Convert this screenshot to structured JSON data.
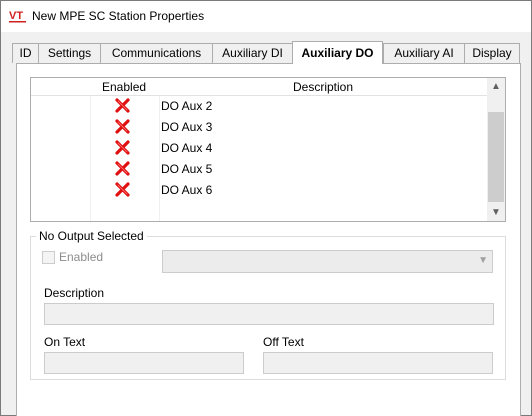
{
  "window": {
    "title": "New MPE SC Station Properties",
    "icon": "vt-app-icon",
    "icon_color": "#d02020"
  },
  "tabs": [
    {
      "label": "ID",
      "active": false
    },
    {
      "label": "Settings",
      "active": false
    },
    {
      "label": "Communications",
      "active": false
    },
    {
      "label": "Auxiliary DI",
      "active": false
    },
    {
      "label": "Auxiliary DO",
      "active": true
    },
    {
      "label": "Auxiliary AI",
      "active": false
    },
    {
      "label": "Display",
      "active": false
    }
  ],
  "grid": {
    "columns": {
      "enabled": "Enabled",
      "description": "Description"
    },
    "rows": [
      {
        "enabled": false,
        "enabled_icon": "red-x-icon",
        "description": "DO Aux 2"
      },
      {
        "enabled": false,
        "enabled_icon": "red-x-icon",
        "description": "DO Aux 3"
      },
      {
        "enabled": false,
        "enabled_icon": "red-x-icon",
        "description": "DO Aux 4"
      },
      {
        "enabled": false,
        "enabled_icon": "red-x-icon",
        "description": "DO Aux 5"
      },
      {
        "enabled": false,
        "enabled_icon": "red-x-icon",
        "description": "DO Aux 6"
      }
    ],
    "x_color": "#e01010"
  },
  "output_group": {
    "title": "No Output Selected",
    "enabled_label": "Enabled",
    "enabled_checked": false,
    "combo_value": "",
    "description_label": "Description",
    "description_value": "",
    "on_text_label": "On Text",
    "on_text_value": "",
    "off_text_label": "Off Text",
    "off_text_value": ""
  }
}
